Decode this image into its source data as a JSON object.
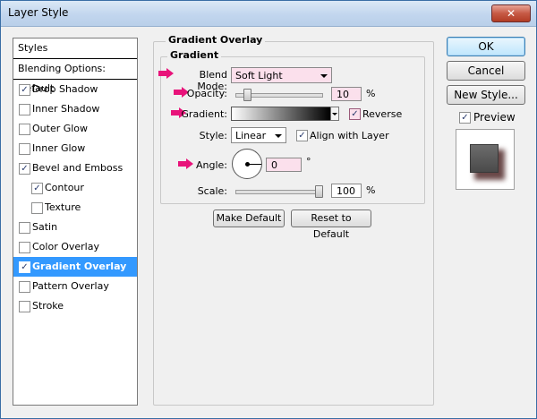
{
  "window": {
    "title": "Layer Style",
    "close_glyph": "✕"
  },
  "styles_list": {
    "header": "Styles",
    "blending_options": "Blending Options: Default",
    "items": [
      {
        "label": "Drop Shadow",
        "checked": true
      },
      {
        "label": "Inner Shadow",
        "checked": false
      },
      {
        "label": "Outer Glow",
        "checked": false
      },
      {
        "label": "Inner Glow",
        "checked": false
      },
      {
        "label": "Bevel and Emboss",
        "checked": true
      },
      {
        "label": "Contour",
        "checked": true,
        "sub": true
      },
      {
        "label": "Texture",
        "checked": false,
        "sub": true
      },
      {
        "label": "Satin",
        "checked": false
      },
      {
        "label": "Color Overlay",
        "checked": false
      },
      {
        "label": "Gradient Overlay",
        "checked": true,
        "selected": true
      },
      {
        "label": "Pattern Overlay",
        "checked": false
      },
      {
        "label": "Stroke",
        "checked": false
      }
    ],
    "check_glyph": "✓"
  },
  "gradient_overlay": {
    "section_title": "Gradient Overlay",
    "group_title": "Gradient",
    "blend_mode_label": "Blend Mode:",
    "blend_mode_value": "Soft Light",
    "opacity_label": "Opacity:",
    "opacity_value": "10",
    "opacity_unit": "%",
    "opacity_level": 10,
    "gradient_label": "Gradient:",
    "gradient_colors": [
      "#ffffff",
      "#000000"
    ],
    "reverse_label": "Reverse",
    "reverse_checked": true,
    "style_label": "Style:",
    "style_value": "Linear",
    "align_label": "Align with Layer",
    "align_checked": true,
    "angle_label": "Angle:",
    "angle_value": "0",
    "angle_unit": "°",
    "scale_label": "Scale:",
    "scale_value": "100",
    "scale_unit": "%",
    "scale_level": 100,
    "make_default": "Make Default",
    "reset_default": "Reset to Default"
  },
  "buttons": {
    "ok": "OK",
    "cancel": "Cancel",
    "new_style": "New Style...",
    "preview_label": "Preview",
    "preview_checked": true
  },
  "colors": {
    "highlight_arrow": "#e8137a",
    "selection": "#3399ff",
    "field_highlight": "#fbe0ec"
  },
  "icons": {
    "arrow": "pointer-arrow-icon",
    "dropdown": "chevron-down-icon",
    "check": "checkmark-icon",
    "close": "close-icon"
  }
}
